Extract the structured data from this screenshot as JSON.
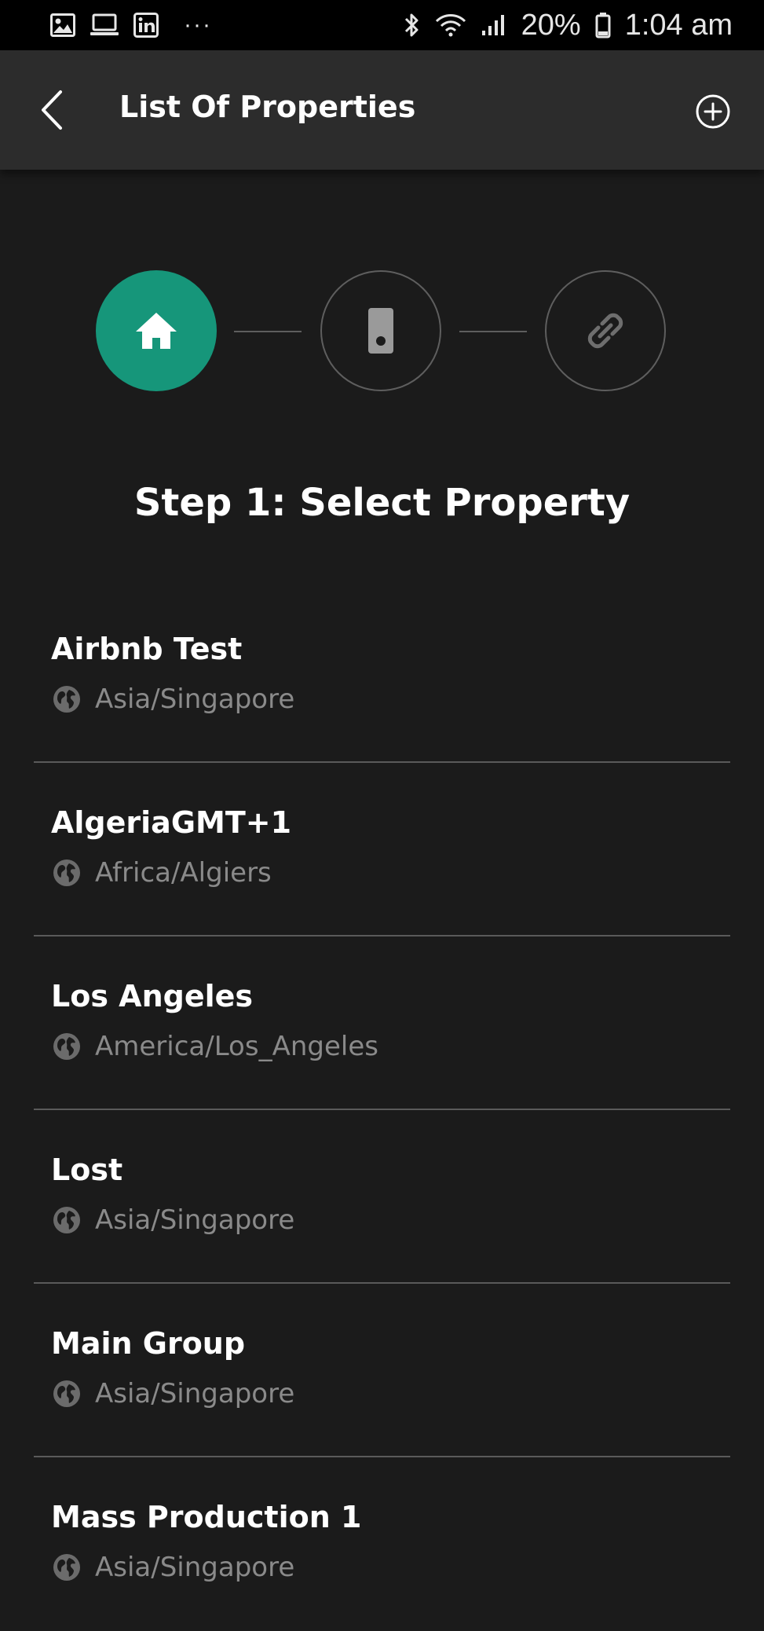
{
  "status_bar": {
    "left_icons": [
      "image-icon",
      "laptop-icon",
      "linkedin-icon"
    ],
    "overflow": "···",
    "battery_percent": "20%",
    "time": "1:04 am"
  },
  "header": {
    "title": "List Of Properties"
  },
  "stepper": {
    "steps": [
      {
        "icon": "home-icon",
        "active": true
      },
      {
        "icon": "lock-device-icon",
        "active": false
      },
      {
        "icon": "link-icon",
        "active": false
      }
    ],
    "active_color": "#16967a"
  },
  "step_title": "Step 1: Select Property",
  "properties": [
    {
      "name": "Airbnb Test",
      "timezone": "Asia/Singapore"
    },
    {
      "name": "AlgeriaGMT+1",
      "timezone": "Africa/Algiers"
    },
    {
      "name": "Los Angeles",
      "timezone": "America/Los_Angeles"
    },
    {
      "name": "Lost",
      "timezone": "Asia/Singapore"
    },
    {
      "name": "Main Group",
      "timezone": "Asia/Singapore"
    },
    {
      "name": "Mass Production 1",
      "timezone": "Asia/Singapore"
    }
  ]
}
